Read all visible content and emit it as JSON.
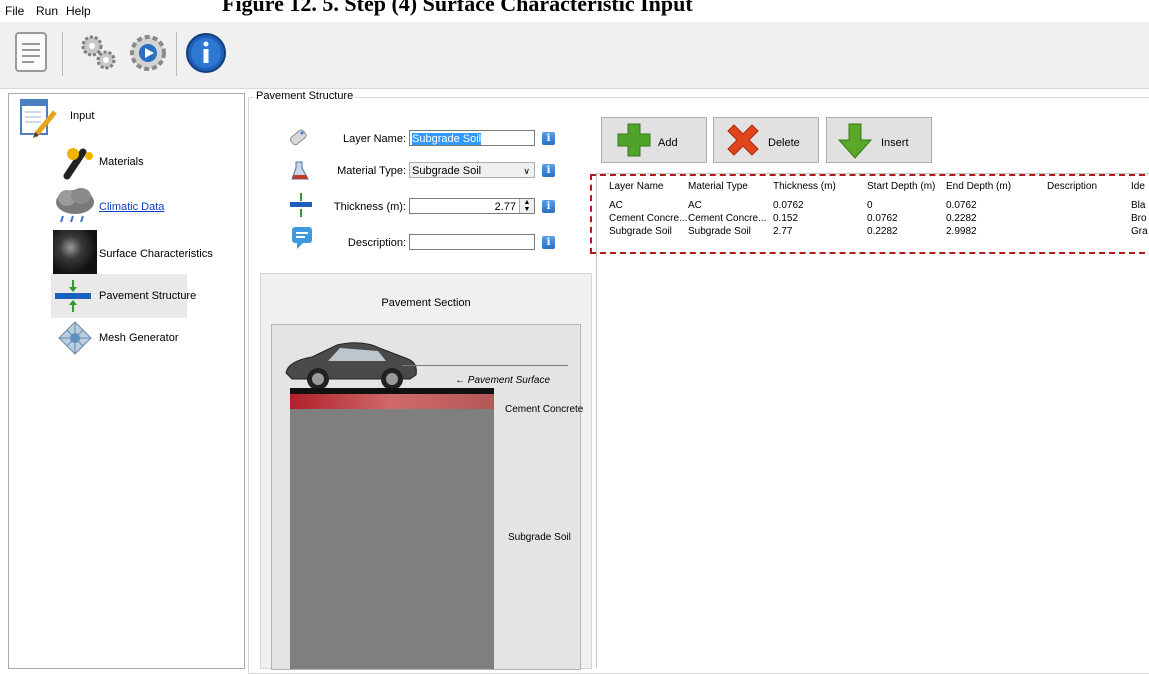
{
  "caption": "Figure 12. 5. Step (4) Surface Characteristic Input",
  "menu": [
    "File",
    "Run",
    "Help"
  ],
  "toolbar_icons": [
    "document-icon",
    "gears-icon",
    "run-gear-icon",
    "info-icon"
  ],
  "sidebar": {
    "items": [
      {
        "label": "Input",
        "icon": "input-icon"
      },
      {
        "label": "Materials",
        "icon": "test-tube-icon"
      },
      {
        "label": "Climatic Data",
        "icon": "storm-cloud-icon"
      },
      {
        "label": "Surface Characteristics",
        "icon": "texture-icon"
      },
      {
        "label": "Pavement Structure",
        "icon": "layers-icon"
      },
      {
        "label": "Mesh Generator",
        "icon": "mesh-icon"
      }
    ]
  },
  "group_title": "Pavement Structure",
  "form": {
    "layer_name_label": "Layer Name:",
    "layer_name_value": "Subgrade Soil",
    "material_type_label": "Material Type:",
    "material_type_value": "Subgrade Soil",
    "thickness_label": "Thickness (m):",
    "thickness_value": "2.77",
    "description_label": "Description:",
    "description_value": "",
    "info_glyph": "i"
  },
  "buttons": {
    "add": "Add",
    "delete": "Delete",
    "insert": "Insert"
  },
  "table": {
    "headers": [
      "Layer Name",
      "Material Type",
      "Thickness (m)",
      "Start Depth (m)",
      "End Depth (m)",
      "Description",
      "Ide"
    ],
    "rows": [
      [
        "AC",
        "AC",
        "0.0762",
        "0",
        "0.0762",
        "",
        "Bla"
      ],
      [
        "Cement Concre...",
        "Cement Concre...",
        "0.152",
        "0.0762",
        "0.2282",
        "",
        "Bro"
      ],
      [
        "Subgrade Soil",
        "Subgrade Soil",
        "2.77",
        "0.2282",
        "2.9982",
        "",
        "Gra"
      ]
    ]
  },
  "pavement_section": {
    "title": "Pavement Section",
    "surface_label": "Pavement Surface",
    "layer_labels": [
      "Cement Concrete",
      "Subgrade Soil"
    ]
  },
  "colors": {
    "highlight": "#b31b1b",
    "add_green": "#4fa32a",
    "delete_red": "#e0451b",
    "link_blue": "#0b3fc0"
  }
}
